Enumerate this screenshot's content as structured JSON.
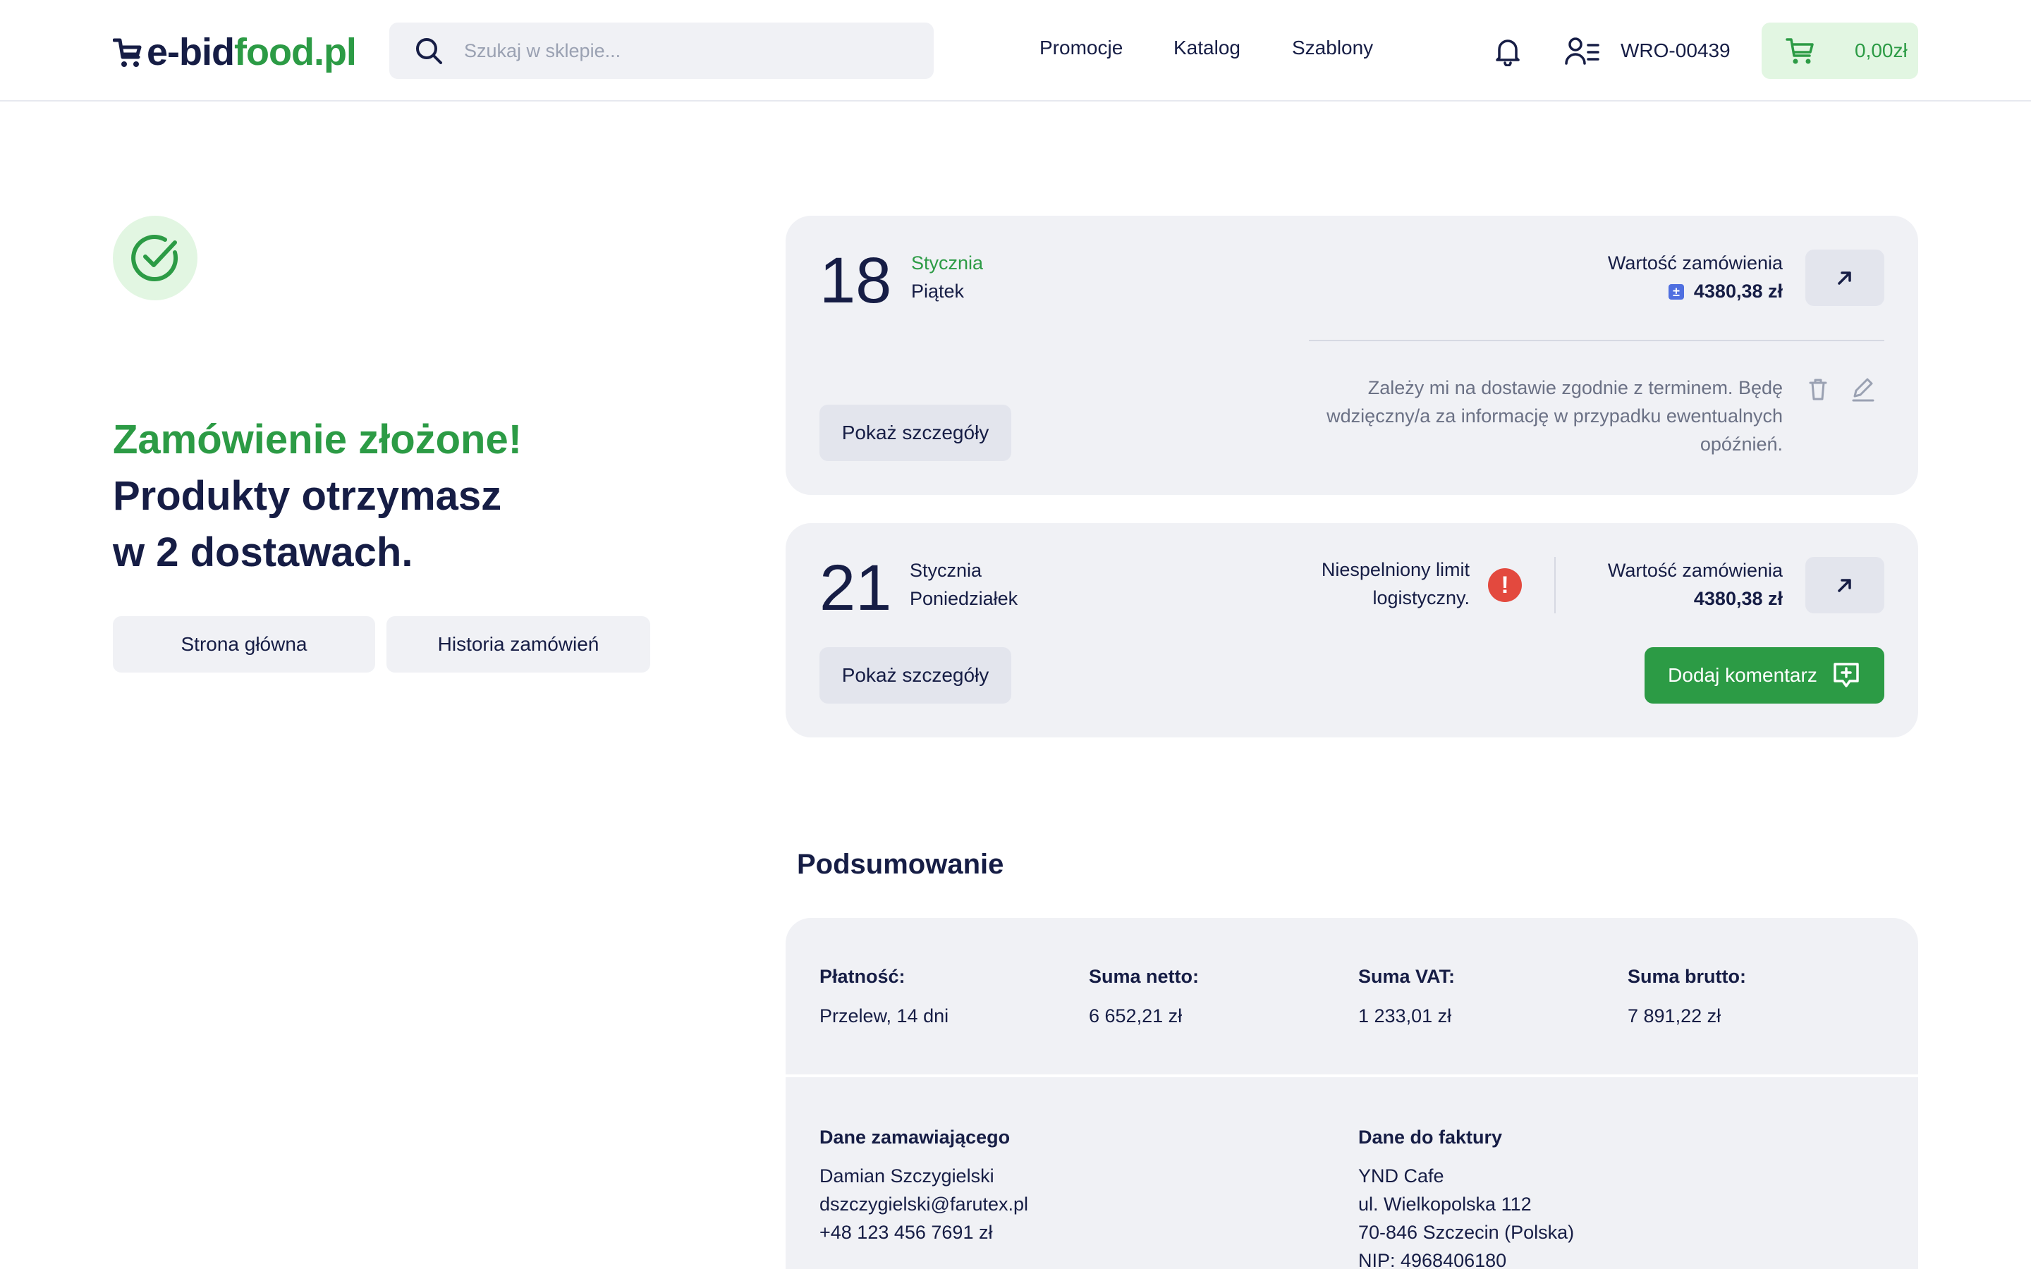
{
  "header": {
    "logo_prefix": "e-bid",
    "logo_suffix": "food.pl",
    "search_placeholder": "Szukaj w sklepie...",
    "nav": [
      "Promocje",
      "Katalog",
      "Szablony"
    ],
    "account_code": "WRO-00439",
    "cart_amount": "0,00zł"
  },
  "confirmation": {
    "title_green": "Zamówienie złożone!",
    "title_line2": "Produkty otrzymasz",
    "title_line3": "w 2 dostawach.",
    "home_button": "Strona główna",
    "history_button": "Historia zamówień"
  },
  "deliveries": [
    {
      "day": "18",
      "month": "Stycznia",
      "weekday": "Piątek",
      "value_label": "Wartość zamówienia",
      "value": "4380,38 zł",
      "details_button": "Pokaż szczegóły",
      "comment_lines": [
        "Zależy mi na dostawie zgodnie z terminem. Będę",
        "wdzięczny/a za informację w przypadku ewentualnych",
        "opóźnień."
      ]
    },
    {
      "day": "21",
      "month": "Stycznia",
      "weekday": "Poniedziałek",
      "warning_lines": [
        "Niespelniony limit",
        "logistyczny."
      ],
      "value_label": "Wartość zamówienia",
      "value": "4380,38 zł",
      "details_button": "Pokaż szczegóły",
      "add_comment_button": "Dodaj komentarz"
    }
  ],
  "summary": {
    "title": "Podsumowanie",
    "payment_label": "Płatność:",
    "payment_value": "Przelew, 14 dni",
    "net_label": "Suma netto:",
    "net_value": "6 652,21 zł",
    "vat_label": "Suma VAT:",
    "vat_value": "1 233,01 zł",
    "gross_label": "Suma brutto:",
    "gross_value": "7 891,22 zł",
    "orderer_label": "Dane zamawiającego",
    "orderer_name": "Damian Szczygielski",
    "orderer_email": "dszczygielski@farutex.pl",
    "orderer_phone": "+48 123 456 7691 zł",
    "invoice_label": "Dane do faktury",
    "invoice_company": "YND Cafe",
    "invoice_street": "ul. Wielkopolska 112",
    "invoice_city": "70-846 Szczecin (Polska)",
    "invoice_nip": "NIP: 4968406180"
  },
  "colors": {
    "brand_green": "#2c9b45",
    "navy": "#161d45",
    "card_bg": "#f0f1f5",
    "alert_red": "#e3493e",
    "light_green": "#e2f6e2"
  }
}
